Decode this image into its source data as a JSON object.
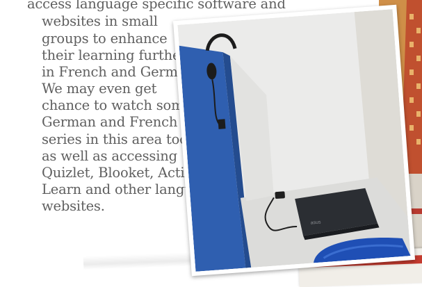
{
  "paragraph": {
    "lines": [
      "access language specific software and",
      "websites in small",
      "groups to enhance",
      "their learning further",
      "in French and German.",
      "We may even get",
      "chance to watch some",
      "German and French",
      "series in this area too,",
      "as well as accessing",
      "Quizlet, Blooket, Active",
      "Learn and other language",
      "websites."
    ]
  },
  "photo": {
    "colors": {
      "desk": "#e4e4e2",
      "wall": "#ececec",
      "partition": "#2f5fb0",
      "chromebook": "#2b2e33",
      "headset": "#1c1c1c",
      "chair": "#1f4fb5"
    },
    "laptop_brand": "asus"
  }
}
